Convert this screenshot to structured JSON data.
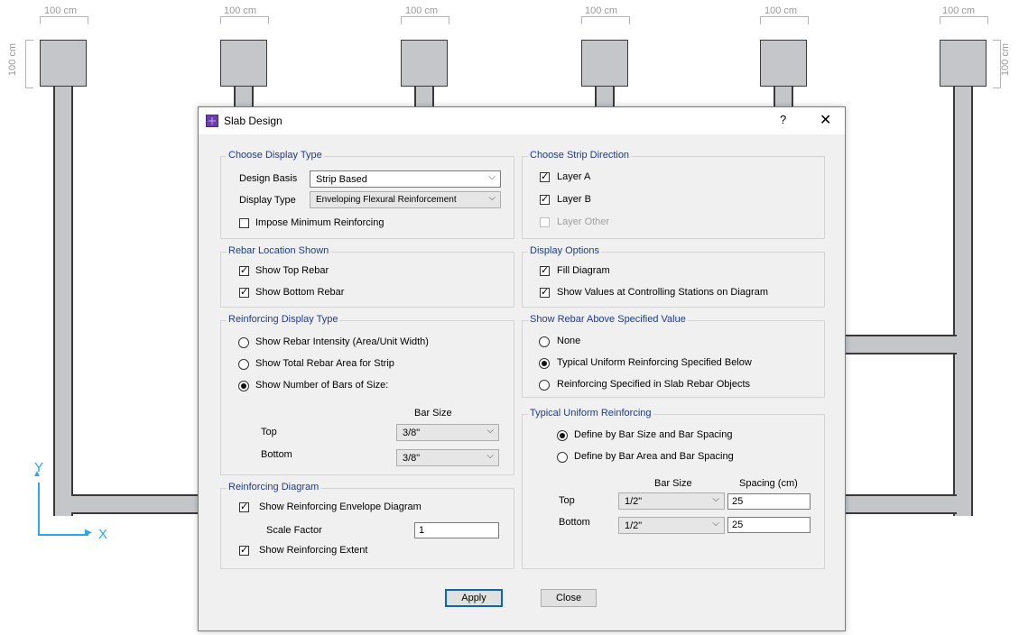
{
  "drawing": {
    "column_width_label": "100 cm",
    "column_depth_label": "100 cm",
    "axis_x": "X",
    "axis_y": "Y"
  },
  "dialog": {
    "title": "Slab Design",
    "help": "?",
    "close": "✕",
    "choose_display_type": {
      "title": "Choose Display Type",
      "design_basis_label": "Design Basis",
      "design_basis_value": "Strip Based",
      "display_type_label": "Display Type",
      "display_type_value": "Enveloping Flexural Reinforcement",
      "impose_min_label": "Impose Minimum Reinforcing",
      "impose_min_checked": false
    },
    "choose_strip_direction": {
      "title": "Choose Strip Direction",
      "layer_a": "Layer A",
      "layer_b": "Layer B",
      "layer_other": "Layer Other"
    },
    "rebar_location": {
      "title": "Rebar Location Shown",
      "top": "Show Top Rebar",
      "bottom": "Show Bottom Rebar"
    },
    "display_options": {
      "title": "Display Options",
      "fill": "Fill Diagram",
      "show_values": "Show Values at Controlling Stations on Diagram"
    },
    "reinforcing_display_type": {
      "title": "Reinforcing Display Type",
      "opt1": "Show Rebar Intensity (Area/Unit Width)",
      "opt2": "Show Total Rebar Area for Strip",
      "opt3": "Show Number of Bars of Size:",
      "selected": 3,
      "bar_size_header": "Bar Size",
      "top_label": "Top",
      "top_value": "3/8\"",
      "bottom_label": "Bottom",
      "bottom_value": "3/8\""
    },
    "show_rebar_above": {
      "title": "Show Rebar Above Specified Value",
      "opt1": "None",
      "opt2": "Typical Uniform Reinforcing Specified Below",
      "opt3": "Reinforcing Specified in Slab Rebar Objects",
      "selected": 2
    },
    "typical_uniform": {
      "title": "Typical Uniform Reinforcing",
      "opt1": "Define by Bar Size and Bar Spacing",
      "opt2": "Define by Bar Area and Bar Spacing",
      "selected": 1,
      "bar_size_header": "Bar Size",
      "spacing_header": "Spacing  (cm)",
      "top_label": "Top",
      "top_bar": "1/2\"",
      "top_spacing": "25",
      "bottom_label": "Bottom",
      "bottom_bar": "1/2\"",
      "bottom_spacing": "25"
    },
    "reinforcing_diagram": {
      "title": "Reinforcing Diagram",
      "envelope": "Show Reinforcing Envelope Diagram",
      "scale_label": "Scale Factor",
      "scale_value": "1",
      "extent": "Show Reinforcing Extent"
    },
    "apply": "Apply",
    "close_btn": "Close"
  }
}
